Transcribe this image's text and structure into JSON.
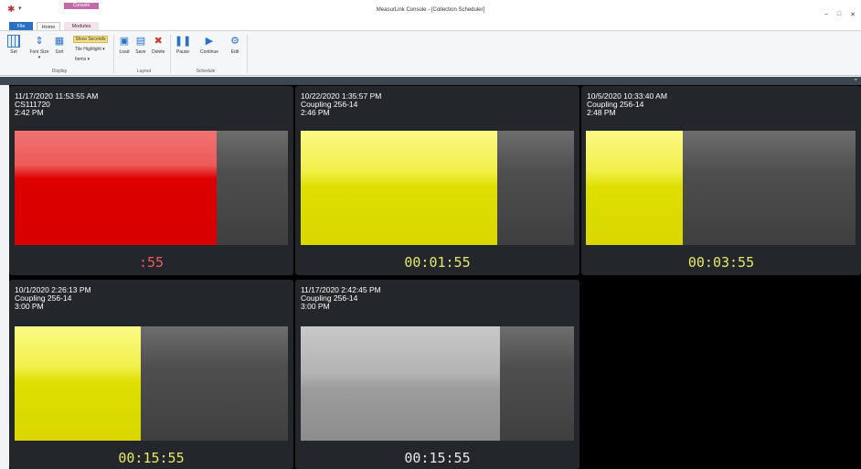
{
  "window": {
    "title": "MeasurLink Console - [Collection Scheduler]",
    "controls": [
      "–",
      "□",
      "✕"
    ]
  },
  "ribbon": {
    "context_tab": "Console",
    "tabs": [
      {
        "label": "File"
      },
      {
        "label": "Home"
      },
      {
        "label": "Modules"
      }
    ],
    "display": {
      "set": "Set",
      "font_size": "Font Size ▾",
      "sort": "Sort",
      "show_seconds": "Show Seconds",
      "tile_highlight": "Tile Highlight ▾",
      "items": "Items ▾",
      "group": "Display"
    },
    "layout": {
      "load": "Load",
      "save": "Save",
      "delete": "Delete",
      "group": "Layout"
    },
    "schedule": {
      "pause": "Pause",
      "continue": "Continue",
      "edit": "Edit",
      "group": "Schedule"
    }
  },
  "colors": {
    "red": "#dc0000",
    "yellow": "#dede00",
    "gray": "#9c9c9c",
    "countdown_red": "#f05a5a",
    "countdown_yellow": "#e8e864",
    "countdown_white": "#e8e8e8"
  },
  "tiles": [
    {
      "timestamp": "11/17/2020 11:53:55 AM",
      "name": "CS111720",
      "due": "2:42 PM",
      "countdown": ":55",
      "state": "red",
      "progress": 0.74
    },
    {
      "timestamp": "10/22/2020 1:35:57 PM",
      "name": "Coupling 256-14",
      "due": "2:46 PM",
      "countdown": "00:01:55",
      "state": "yellow",
      "progress": 0.72
    },
    {
      "timestamp": "10/5/2020 10:33:40 AM",
      "name": "Coupling 256-14",
      "due": "2:48 PM",
      "countdown": "00:03:55",
      "state": "yellow",
      "progress": 0.36
    },
    {
      "timestamp": "10/1/2020 2:26:13 PM",
      "name": "Coupling 256-14",
      "due": "3:00 PM",
      "countdown": "00:15:55",
      "state": "yellow",
      "progress": 0.46
    },
    {
      "timestamp": "11/17/2020 2:42:45 PM",
      "name": "Coupling 256-14",
      "due": "3:00 PM",
      "countdown": "00:15:55",
      "state": "gray",
      "progress": 0.73
    }
  ]
}
